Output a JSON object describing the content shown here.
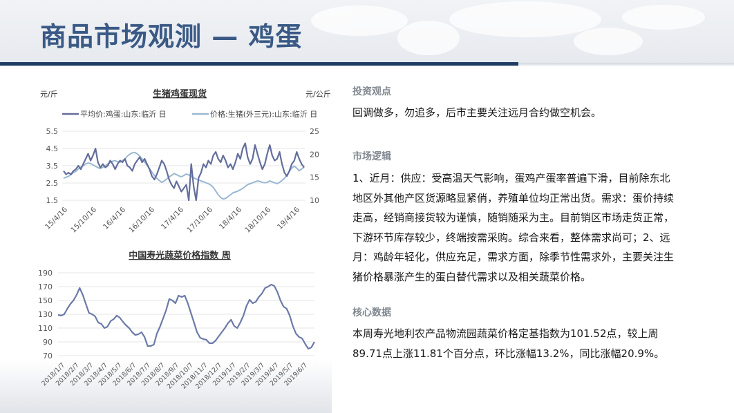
{
  "header": {
    "title": "商品市场观测 — 鸡蛋"
  },
  "colors": {
    "title": "#3a5a85",
    "rule": "#1f3c63",
    "series_dark": "#636e9c",
    "series_light": "#9ab7d2",
    "veg": "#6c7aa8"
  },
  "chart_data": [
    {
      "type": "line",
      "title": "生猪鸡蛋现货",
      "ylabel_left": "元/斤",
      "ylabel_right": "元/公斤",
      "x_ticks": [
        "15/4/16",
        "15/10/16",
        "16/4/16",
        "16/10/16",
        "17/4/16",
        "17/10/16",
        "18/4/16",
        "18/10/16",
        "19/4/16"
      ],
      "yleft_ticks": [
        "5.5",
        "4.5",
        "3.5",
        "2.5",
        "1.5"
      ],
      "yright_ticks": [
        "25",
        "20",
        "15",
        "10"
      ],
      "ylim_left": [
        1.5,
        5.5
      ],
      "ylim_right": [
        10,
        25
      ],
      "legend_position": "top",
      "series": [
        {
          "name": "平均价:鸡蛋:山东:临沂 日",
          "axis": "left",
          "values": [
            3.2,
            3.0,
            3.1,
            3.0,
            3.2,
            3.3,
            3.5,
            3.3,
            3.6,
            3.9,
            4.2,
            3.8,
            4.1,
            4.5,
            3.7,
            3.4,
            3.6,
            3.4,
            3.5,
            3.8,
            3.6,
            3.3,
            3.6,
            3.8,
            3.7,
            3.9,
            3.5,
            3.4,
            3.2,
            3.6,
            3.8,
            4.0,
            3.7,
            3.9,
            3.6,
            3.3,
            2.9,
            2.7,
            3.0,
            3.4,
            3.8,
            3.6,
            3.2,
            2.7,
            2.4,
            2.2,
            2.6,
            2.3,
            2.0,
            2.2,
            2.4,
            1.5,
            3.6,
            2.3,
            1.5,
            2.8,
            3.1,
            3.6,
            3.4,
            3.8,
            3.6,
            4.1,
            4.3,
            3.9,
            3.7,
            4.1,
            3.8,
            3.4,
            3.6,
            3.3,
            3.7,
            4.2,
            3.9,
            4.5,
            4.8,
            4.0,
            3.6,
            3.9,
            4.7,
            4.2,
            3.7,
            3.3,
            3.6,
            4.2,
            4.7,
            4.1,
            3.8,
            3.9,
            4.3,
            3.6,
            3.1,
            2.9,
            3.2,
            3.6,
            3.8,
            4.3,
            3.9,
            3.6,
            3.4
          ]
        },
        {
          "name": "价格:生猪(外三元):山东:临沂 日",
          "axis": "right",
          "values": [
            14.8,
            15.0,
            15.2,
            15.6,
            16.0,
            16.3,
            16.8,
            17.2,
            17.5,
            17.9,
            18.1,
            18.0,
            17.7,
            17.4,
            17.1,
            16.9,
            17.2,
            17.5,
            17.9,
            18.2,
            18.5,
            18.6,
            18.4,
            18.3,
            18.6,
            19.0,
            19.6,
            20.0,
            20.3,
            20.4,
            20.1,
            19.6,
            19.0,
            18.3,
            17.6,
            16.9,
            16.1,
            15.4,
            14.8,
            14.3,
            13.9,
            14.2,
            14.6,
            15.1,
            15.4,
            15.8,
            15.6,
            15.3,
            15.1,
            15.4,
            15.7,
            15.5,
            15.2,
            14.9,
            14.6,
            14.4,
            14.2,
            14.0,
            13.8,
            13.6,
            13.3,
            12.8,
            12.0,
            11.2,
            10.6,
            10.3,
            10.4,
            10.8,
            11.2,
            11.6,
            11.8,
            12.0,
            12.3,
            12.6,
            13.0,
            13.4,
            13.6,
            13.8,
            14.0,
            14.2,
            14.1,
            13.9,
            13.8,
            13.9,
            14.2,
            14.0,
            13.8,
            13.6,
            13.9,
            14.3,
            14.8,
            15.5,
            16.3,
            17.0,
            17.4,
            17.0,
            16.4,
            16.8,
            17.2
          ]
        }
      ]
    },
    {
      "type": "line",
      "title": "中国寿光蔬菜价格指数 周",
      "x_ticks": [
        "2018/1/7",
        "2018/2/7",
        "2018/3/7",
        "2018/4/7",
        "2018/5/7",
        "2018/6/7",
        "2018/7/7",
        "2018/8/7",
        "2018/9/7",
        "2018/10/7",
        "2018/11/7",
        "2018/12/7",
        "2019/1/7",
        "2019/2/7",
        "2019/3/7",
        "2019/4/7",
        "2019/5/7",
        "2019/6/7"
      ],
      "y_ticks": [
        "190",
        "170",
        "150",
        "130",
        "110",
        "90",
        "70"
      ],
      "ylim": [
        70,
        190
      ],
      "series": [
        {
          "name": "",
          "values": [
            129,
            128,
            130,
            138,
            145,
            150,
            158,
            168,
            158,
            145,
            132,
            130,
            127,
            118,
            116,
            110,
            112,
            120,
            123,
            128,
            125,
            119,
            114,
            110,
            104,
            100,
            101,
            104,
            97,
            84,
            84,
            86,
            102,
            112,
            124,
            136,
            152,
            150,
            146,
            157,
            155,
            157,
            146,
            132,
            118,
            104,
            96,
            94,
            93,
            88,
            88,
            92,
            98,
            104,
            110,
            117,
            122,
            113,
            110,
            118,
            128,
            142,
            151,
            146,
            148,
            155,
            160,
            168,
            170,
            173,
            171,
            162,
            150,
            141,
            138,
            128,
            113,
            102,
            97,
            95,
            87,
            80,
            82,
            90
          ]
        }
      ]
    }
  ],
  "sections": [
    {
      "heading": "投资观点",
      "body": "回调做多，勿追多，后市主要关注远月合约做空机会。"
    },
    {
      "heading": "市场逻辑",
      "body": "1、近月：供应：受高温天气影响，蛋鸡产蛋率普遍下滑，目前除东北地区外其他产区货源略显紧俏，养殖单位均正常出货。需求：蛋价持续走高，经销商接货较为谨慎，随销随采为主。目前销区市场走货正常，下游环节库存较少，终端按需采购。综合来看，整体需求尚可；2、远月：鸡龄年轻化，供应充足，需求方面，除季节性需求外，主要关注生猪价格暴涨产生的蛋白替代需求以及相关蔬菜价格。"
    },
    {
      "heading": "核心数据",
      "body": "本周寿光地利农产品物流园蔬菜价格定基指数为101.52点，较上周89.71点上涨11.81个百分点，环比涨幅13.2%，同比涨幅20.9%。"
    }
  ]
}
